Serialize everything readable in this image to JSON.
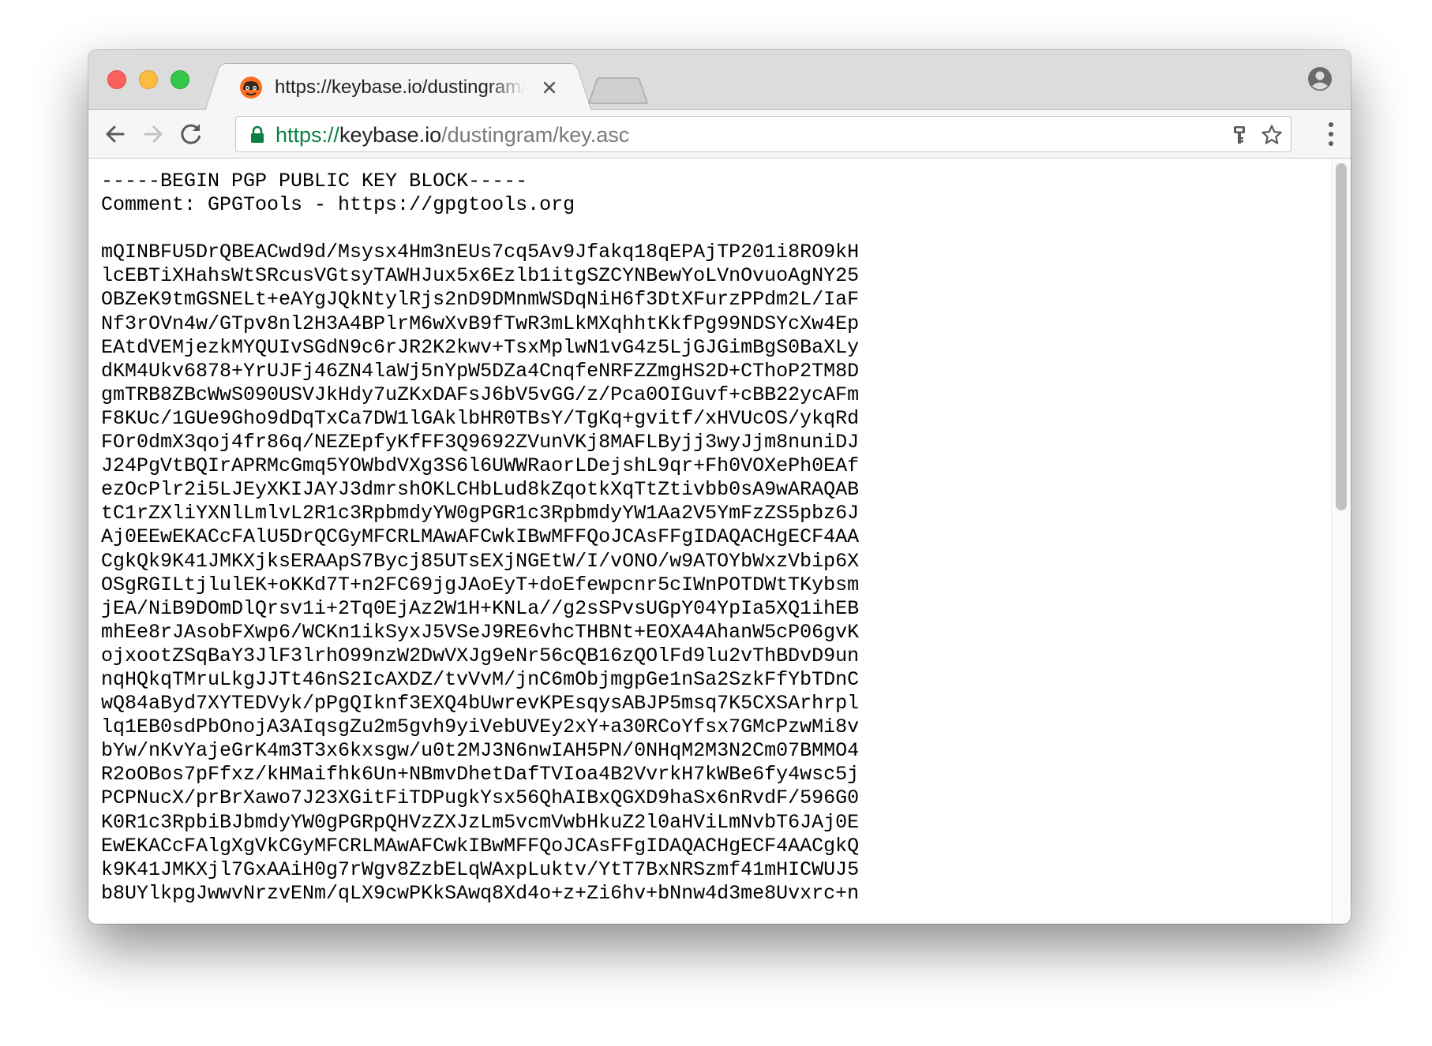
{
  "browser": {
    "tab": {
      "title": "https://keybase.io/dustingram/key.asc",
      "favicon": "keybase-icon",
      "close_icon": "close-icon"
    },
    "new_tab_icon": "new-tab-icon",
    "profile_icon": "profile-icon",
    "toolbar": {
      "back_icon": "back-arrow-icon",
      "forward_icon": "forward-arrow-icon",
      "reload_icon": "reload-icon",
      "url": {
        "scheme": "https://",
        "host": "keybase.io",
        "path": "/dustingram/key.asc"
      },
      "lock_icon": "lock-icon",
      "key_icon": "key-icon",
      "star_icon": "star-icon",
      "menu_icon": "more-menu-icon"
    },
    "colors": {
      "secure_scheme": "#0b8043",
      "close_red": "#fc605b",
      "minimize_yellow": "#fdbc40",
      "zoom_green": "#34c84a"
    }
  },
  "document": {
    "lines": [
      "-----BEGIN PGP PUBLIC KEY BLOCK-----",
      "Comment: GPGTools - https://gpgtools.org",
      "",
      "mQINBFU5DrQBEACwd9d/Msysx4Hm3nEUs7cq5Av9Jfakq18qEPAjTP201i8RO9kH",
      "lcEBTiXHahsWtSRcusVGtsyTAWHJux5x6Ezlb1itgSZCYNBewYoLVnOvuoAgNY25",
      "OBZeK9tmGSNELt+eAYgJQkNtylRjs2nD9DMnmWSDqNiH6f3DtXFurzPPdm2L/IaF",
      "Nf3rOVn4w/GTpv8nl2H3A4BPlrM6wXvB9fTwR3mLkMXqhhtKkfPg99NDSYcXw4Ep",
      "EAtdVEMjezkMYQUIvSGdN9c6rJR2K2kwv+TsxMplwN1vG4z5LjGJGimBgS0BaXLy",
      "dKM4Ukv6878+YrUJFj46ZN4laWj5nYpW5DZa4CnqfeNRFZZmgHS2D+CThoP2TM8D",
      "gmTRB8ZBcWwS090USVJkHdy7uZKxDAFsJ6bV5vGG/z/Pca0OIGuvf+cBB22ycAFm",
      "F8KUc/1GUe9Gho9dDqTxCa7DW1lGAklbHR0TBsY/TgKq+gvitf/xHVUcOS/ykqRd",
      "FOr0dmX3qoj4fr86q/NEZEpfyKfFF3Q9692ZVunVKj8MAFLByjj3wyJjm8nuniDJ",
      "J24PgVtBQIrAPRMcGmq5YOWbdVXg3S6l6UWWRaorLDejshL9qr+Fh0VOXePh0EAf",
      "ezOcPlr2i5LJEyXKIJAYJ3dmrshOKLCHbLud8kZqotkXqTtZtivbb0sA9wARAQAB",
      "tC1rZXliYXNlLmlvL2R1c3RpbmdyYW0gPGR1c3RpbmdyYW1Aa2V5YmFzZS5pbz6J",
      "Aj0EEwEKACcFAlU5DrQCGyMFCRLMAwAFCwkIBwMFFQoJCAsFFgIDAQACHgECF4AA",
      "CgkQk9K41JMKXjksERAApS7Bycj85UTsEXjNGEtW/I/vONO/w9ATOYbWxzVbip6X",
      "OSgRGILtjlulEK+oKKd7T+n2FC69jgJAoEyT+doEfewpcnr5cIWnPOTDWtTKybsm",
      "jEA/NiB9DOmDlQrsv1i+2Tq0EjAz2W1H+KNLa//g2sSPvsUGpY04YpIa5XQ1ihEB",
      "mhEe8rJAsobFXwp6/WCKn1ikSyxJ5VSeJ9RE6vhcTHBNt+EOXA4AhanW5cP06gvK",
      "ojxootZSqBaY3JlF3lrhO99nzW2DwVXJg9eNr56cQB16zQOlFd9lu2vThBDvD9un",
      "nqHQkqTMruLkgJJTt46nS2IcAXDZ/tvVvM/jnC6mObjmgpGe1nSa2SzkFfYbTDnC",
      "wQ84aByd7XYTEDVyk/pPgQIknf3EXQ4bUwrevKPEsqysABJP5msq7K5CXSArhrpl",
      "lq1EB0sdPbOnojA3AIqsgZu2m5gvh9yiVebUVEy2xY+a30RCoYfsx7GMcPzwMi8v",
      "bYw/nKvYajeGrK4m3T3x6kxsgw/u0t2MJ3N6nwIAH5PN/0NHqM2M3N2Cm07BMMO4",
      "R2oOBos7pFfxz/kHMaifhk6Un+NBmvDhetDafTVIoa4B2VvrkH7kWBe6fy4wsc5j",
      "PCPNucX/prBrXawo7J23XGitFiTDPugkYsx56QhAIBxQGXD9haSx6nRvdF/596G0",
      "K0R1c3RpbiBJbmdyYW0gPGRpQHVzZXJzLm5vcmVwbHkuZ2l0aHViLmNvbT6JAj0E",
      "EwEKACcFAlgXgVkCGyMFCRLMAwAFCwkIBwMFFQoJCAsFFgIDAQACHgECF4AACgkQ",
      "k9K41JMKXjl7GxAAiH0g7rWgv8ZzbELqWAxpLuktv/YtT7BxNRSzmf41mHICWUJ5",
      "b8UYlkpgJwwvNrzvENm/qLX9cwPKkSAwq8Xd4o+z+Zi6hv+bNnw4d3me8Uvxrc+n"
    ]
  }
}
